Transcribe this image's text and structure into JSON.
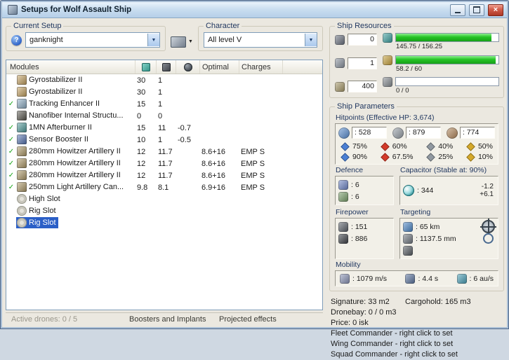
{
  "window": {
    "title": "Setups for Wolf Assault Ship",
    "close_glyph": "×"
  },
  "icons": {
    "dropdown_arrow": "▼",
    "help": "?"
  },
  "setup": {
    "label": "Current Setup",
    "value": "ganknight"
  },
  "character": {
    "label": "Character",
    "value": "All level V"
  },
  "modules": {
    "title": "Modules",
    "optimal_header": "Optimal",
    "charges_header": "Charges",
    "rows": [
      {
        "check": "",
        "icon": "gyrostabilizer-icon",
        "color": "#c8a35f",
        "name": "Gyrostabilizer II",
        "cpu": "30",
        "pg": "1",
        "cap": "",
        "optimal": "",
        "charges": ""
      },
      {
        "check": "",
        "icon": "gyrostabilizer-icon",
        "color": "#c8a35f",
        "name": "Gyrostabilizer II",
        "cpu": "30",
        "pg": "1",
        "cap": "",
        "optimal": "",
        "charges": ""
      },
      {
        "check": "✓",
        "icon": "tracking-enhancer-icon",
        "color": "#8fb0c8",
        "name": "Tracking Enhancer II",
        "cpu": "15",
        "pg": "1",
        "cap": "",
        "optimal": "",
        "charges": ""
      },
      {
        "check": "",
        "icon": "nanofiber-structure-icon",
        "color": "#57554c",
        "name": "Nanofiber Internal Structu...",
        "cpu": "0",
        "pg": "0",
        "cap": "",
        "optimal": "",
        "charges": ""
      },
      {
        "check": "✓",
        "icon": "afterburner-icon",
        "color": "#4f9d9d",
        "name": "1MN Afterburner II",
        "cpu": "15",
        "pg": "11",
        "cap": "-0.7",
        "optimal": "",
        "charges": ""
      },
      {
        "check": "✓",
        "icon": "sensor-booster-icon",
        "color": "#5574b4",
        "name": "Sensor Booster II",
        "cpu": "10",
        "pg": "1",
        "cap": "-0.5",
        "optimal": "",
        "charges": ""
      },
      {
        "check": "✓",
        "icon": "artillery-icon",
        "color": "#b09a67",
        "name": "280mm Howitzer Artillery II",
        "cpu": "12",
        "pg": "11.7",
        "cap": "",
        "optimal": "8.6+16",
        "charges": "EMP S"
      },
      {
        "check": "✓",
        "icon": "artillery-icon",
        "color": "#b09a67",
        "name": "280mm Howitzer Artillery II",
        "cpu": "12",
        "pg": "11.7",
        "cap": "",
        "optimal": "8.6+16",
        "charges": "EMP S"
      },
      {
        "check": "✓",
        "icon": "artillery-icon",
        "color": "#b09a67",
        "name": "280mm Howitzer Artillery II",
        "cpu": "12",
        "pg": "11.7",
        "cap": "",
        "optimal": "8.6+16",
        "charges": "EMP S"
      },
      {
        "check": "✓",
        "icon": "artillery-icon",
        "color": "#b09a67",
        "name": "250mm Light Artillery Can...",
        "cpu": "9.8",
        "pg": "8.1",
        "cap": "",
        "optimal": "6.9+16",
        "charges": "EMP S"
      },
      {
        "check": "",
        "icon": "high-slot-icon",
        "color": "#cfcdc3",
        "name": "High Slot",
        "cpu": "",
        "pg": "",
        "cap": "",
        "optimal": "",
        "charges": "",
        "slot": true
      },
      {
        "check": "",
        "icon": "rig-slot-icon",
        "color": "#cfcdc3",
        "name": "Rig Slot",
        "cpu": "",
        "pg": "",
        "cap": "",
        "optimal": "",
        "charges": "",
        "slot": true
      },
      {
        "check": "",
        "icon": "rig-slot-icon",
        "color": "#cfcdc3",
        "name": "Rig Slot",
        "cpu": "",
        "pg": "",
        "cap": "",
        "optimal": "",
        "charges": "",
        "slot": true,
        "selected": true
      }
    ]
  },
  "statusbar": {
    "active_drones": "Active drones: 0 / 5",
    "boosters": "Boosters and Implants",
    "projected": "Projected effects"
  },
  "resources": {
    "label": "Ship Resources",
    "slots": [
      {
        "icon": "turret-hardpoints-icon",
        "color": "#6b7280",
        "value": "0"
      },
      {
        "icon": "launcher-hardpoints-icon",
        "color": "#8a93a0",
        "value": "1"
      },
      {
        "icon": "calibration-icon",
        "color": "#a89968",
        "value": "400"
      }
    ],
    "bars": [
      {
        "icon": "cpu-icon",
        "color": "#3aa0a0",
        "text": "145.75 / 156.25",
        "fill": 93
      },
      {
        "icon": "powergrid-icon",
        "color": "#c9a23a",
        "text": "58.2 / 60",
        "fill": 97
      },
      {
        "icon": "drone-bandwidth-icon",
        "color": "#868c92",
        "text": "0 / 0",
        "fill": 0
      }
    ]
  },
  "parameters": {
    "label": "Ship Parameters",
    "hitpoints": {
      "label": "Hitpoints (Effective HP: 3,674)",
      "values": [
        {
          "icon": "shield-icon",
          "color": "#5a8fd4",
          "value": ": 528"
        },
        {
          "icon": "armor-icon",
          "color": "#98a0a8",
          "value": ": 879"
        },
        {
          "icon": "structure-icon",
          "color": "#b5885a",
          "value": ": 774"
        }
      ],
      "resists": [
        {
          "icon": "em-resist-icon",
          "color": "#4a7fd4",
          "shield": "75%",
          "armor": "90%"
        },
        {
          "icon": "thermal-resist-icon",
          "color": "#d43a2a",
          "shield": "60%",
          "armor": "67.5%"
        },
        {
          "icon": "kinetic-resist-icon",
          "color": "#9098a0",
          "shield": "40%",
          "armor": "25%"
        },
        {
          "icon": "explosive-resist-icon",
          "color": "#d4a82a",
          "shield": "50%",
          "armor": "10%"
        }
      ]
    },
    "defence": {
      "label": "Defence",
      "rows": [
        {
          "icon": "shield-defence-icon",
          "color": "#6f86c8",
          "value": ": 6"
        },
        {
          "icon": "armor-defence-icon",
          "color": "#7aa06a",
          "value": ": 6"
        }
      ]
    },
    "capacitor": {
      "label": "Capacitor (Stable at: 90%)",
      "value": ": 344",
      "delta_minus": "-1.2",
      "delta_plus": "+6.1"
    },
    "firepower": {
      "label": "Firepower",
      "rows": [
        {
          "icon": "turret-damage-icon",
          "color": "#5a6068",
          "value": ": 151"
        },
        {
          "icon": "volley-icon",
          "color": "#3a3e44",
          "value": ": 886"
        }
      ]
    },
    "targeting": {
      "label": "Targeting",
      "rows": [
        {
          "icon": "targeting-range-icon",
          "color": "#4a86c8",
          "value": ": 65 km",
          "right_icon": "crosshair-icon"
        },
        {
          "icon": "scan-resolution-icon",
          "color": "#707880",
          "value": ": 1137.5 mm",
          "right_icon": "lock-targets-icon"
        },
        {
          "icon": "sensor-strength-icon",
          "color": "#555b61",
          "value": "",
          "right_icon": ""
        }
      ]
    },
    "mobility": {
      "label": "Mobility",
      "items": [
        {
          "icon": "max-velocity-icon",
          "color": "#8a94b8",
          "value": ": 1079 m/s"
        },
        {
          "icon": "align-time-icon",
          "color": "#5a74a0",
          "value": ": 4.4 s"
        },
        {
          "icon": "warp-speed-icon",
          "color": "#48a0b8",
          "value": ": 6 au/s"
        }
      ]
    }
  },
  "footer": {
    "signature": "Signature: 33 m2",
    "cargohold": "Cargohold: 165 m3",
    "lines": [
      "Dronebay: 0 / 0 m3",
      "Price: 0 isk",
      "Fleet Commander - right click to set",
      "Wing Commander - right click to set",
      "Squad Commander - right click to set"
    ]
  }
}
